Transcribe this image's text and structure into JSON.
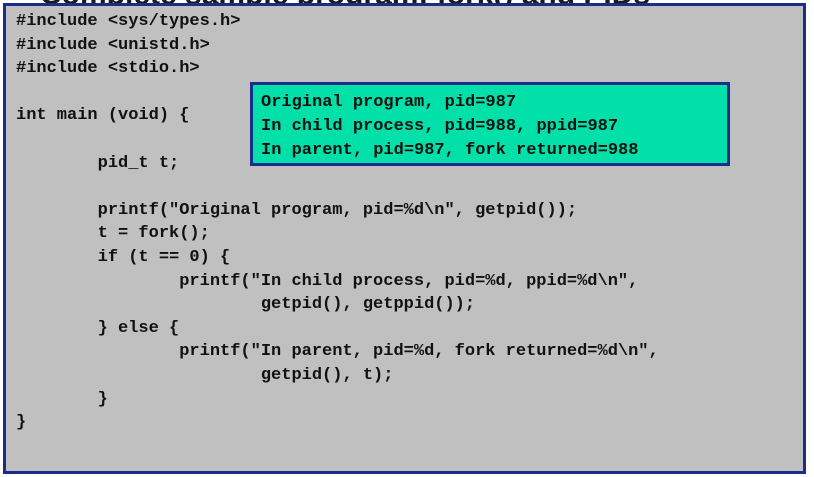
{
  "heading": "Complete sample program: fork() and PIDs",
  "code": {
    "lines": [
      "#include <sys/types.h>",
      "#include <unistd.h>",
      "#include <stdio.h>",
      "",
      "int main (void) {",
      "",
      "        pid_t t;",
      "",
      "        printf(\"Original program, pid=%d\\n\", getpid());",
      "        t = fork();",
      "        if (t == 0) {",
      "                printf(\"In child process, pid=%d, ppid=%d\\n\",",
      "                        getpid(), getppid());",
      "        } else {",
      "                printf(\"In parent, pid=%d, fork returned=%d\\n\",",
      "                        getpid(), t);",
      "        }",
      "}"
    ]
  },
  "output": {
    "lines": [
      "Original program, pid=987",
      "In child process, pid=988, ppid=987",
      "In parent, pid=987, fork returned=988"
    ]
  },
  "colors": {
    "code_background": "#c0c0c0",
    "border": "#1a2d8c",
    "output_background": "#00e0a8",
    "text": "#111111"
  }
}
